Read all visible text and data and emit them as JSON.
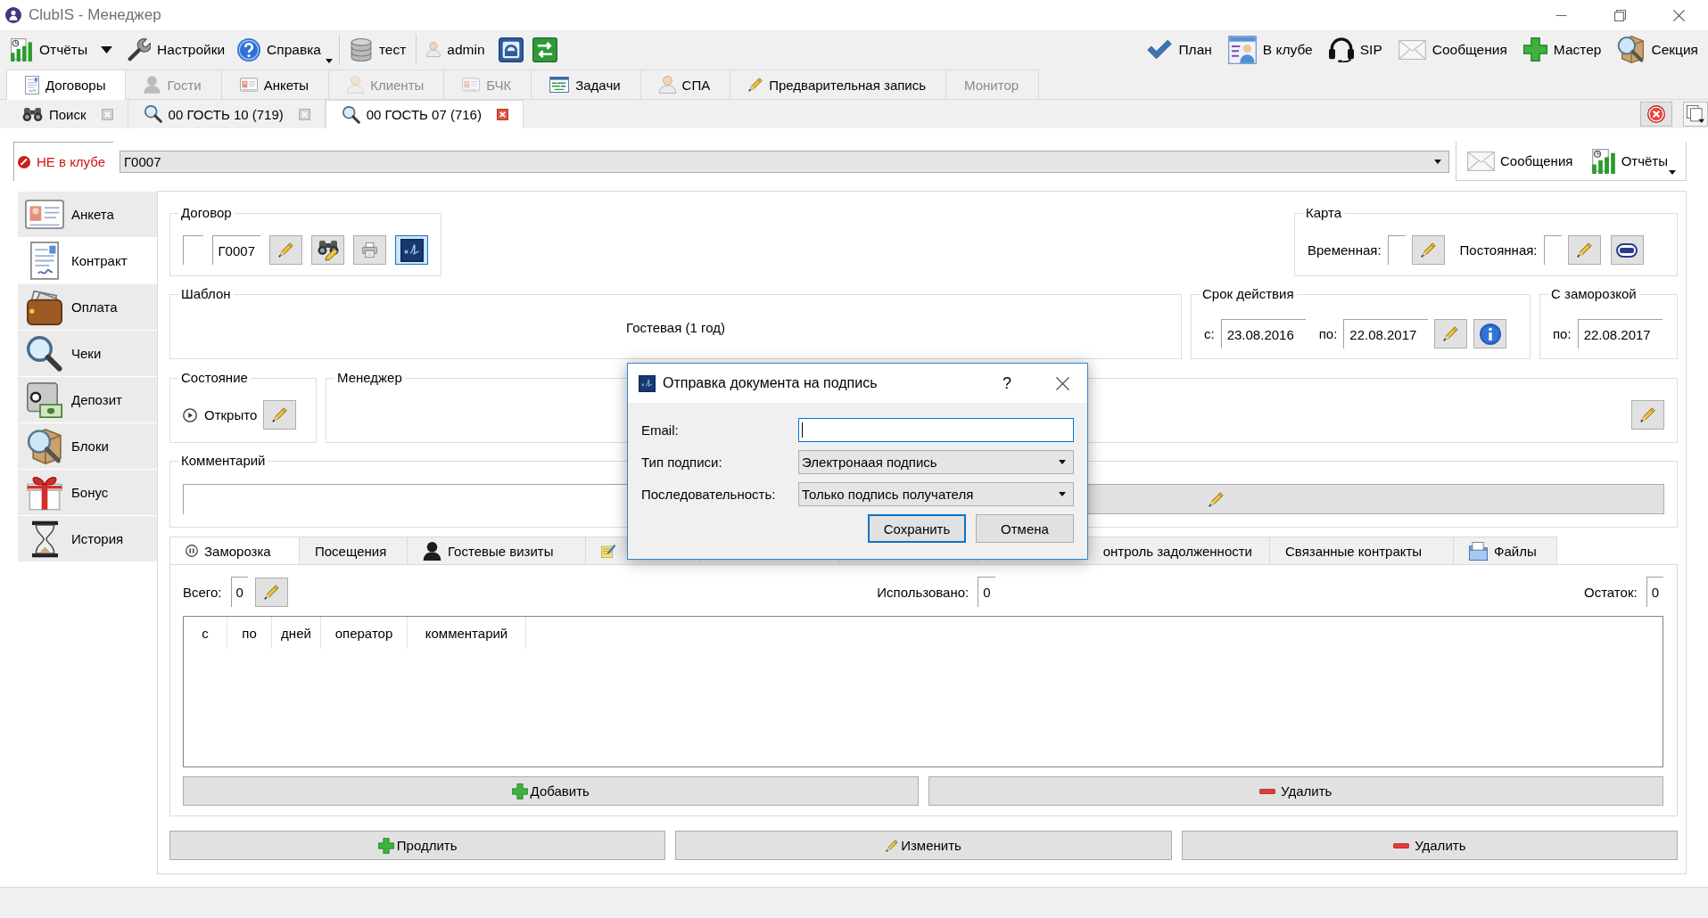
{
  "window": {
    "title": "ClubIS - Менеджер"
  },
  "toolbar": {
    "left": [
      "Отчёты",
      "Настройки",
      "Справка",
      "тест",
      "admin"
    ],
    "right": [
      "План",
      "В клубе",
      "SIP",
      "Сообщения",
      "Мастер",
      "Секция"
    ]
  },
  "main_tabs": [
    {
      "label": "Договоры",
      "selected": true,
      "disabled": false
    },
    {
      "label": "Гости",
      "selected": false,
      "disabled": true
    },
    {
      "label": "Анкеты",
      "selected": false,
      "disabled": false
    },
    {
      "label": "Клиенты",
      "selected": false,
      "disabled": true
    },
    {
      "label": "БЧК",
      "selected": false,
      "disabled": true
    },
    {
      "label": "Задачи",
      "selected": false,
      "disabled": false
    },
    {
      "label": "СПА",
      "selected": false,
      "disabled": false
    },
    {
      "label": "Предварительная запись",
      "selected": false,
      "disabled": false
    },
    {
      "label": "Монитор",
      "selected": false,
      "disabled": true
    }
  ],
  "document_tabs": [
    {
      "label": "Поиск",
      "selected": false
    },
    {
      "label": "00 ГОСТЬ 10 (719)",
      "selected": false
    },
    {
      "label": "00 ГОСТЬ 07 (716)",
      "selected": true
    }
  ],
  "client_bar": {
    "status": "НЕ в клубе",
    "client": "Г0007",
    "buttons": [
      "Сообщения",
      "Отчёты"
    ]
  },
  "sidebar": {
    "items": [
      {
        "label": "Анкета",
        "selected": false
      },
      {
        "label": "Контракт",
        "selected": true
      },
      {
        "label": "Оплата",
        "selected": false
      },
      {
        "label": "Чеки",
        "selected": false
      },
      {
        "label": "Депозит",
        "selected": false
      },
      {
        "label": "Блоки",
        "selected": false
      },
      {
        "label": "Бонус",
        "selected": false
      },
      {
        "label": "История",
        "selected": false
      }
    ]
  },
  "contract": {
    "title": "Договор",
    "number": "Г0007",
    "tool_buttons": [
      {
        "pressed": false
      },
      {
        "pressed": false
      },
      {
        "pressed": false
      },
      {
        "pressed": true
      }
    ]
  },
  "card": {
    "title": "Карта",
    "temporary_label": "Временная:",
    "permanent_label": "Постоянная:"
  },
  "template": {
    "title": "Шаблон",
    "value": "Гостевая (1 год)"
  },
  "validity": {
    "title": "Срок действия",
    "from_label": "с:",
    "from": "23.08.2016",
    "to_label": "по:",
    "to": "22.08.2017"
  },
  "with_freeze": {
    "title": "С заморозкой",
    "to_label": "по:",
    "to": "22.08.2017"
  },
  "state": {
    "title": "Состояние",
    "value": "Открыто"
  },
  "manager": {
    "title": "Менеджер"
  },
  "comment": {
    "title": "Комментарий"
  },
  "detail_tabs": [
    {
      "label": "Заморозка",
      "selected": true
    },
    {
      "label": "Посещения",
      "selected": false
    },
    {
      "label": "Гостевые визиты",
      "selected": false
    },
    {
      "selected": false
    },
    {
      "label": "онтроль задолженности",
      "selected": false
    },
    {
      "label": "Связанные контракты",
      "selected": false
    },
    {
      "label": "Файлы",
      "selected": false
    }
  ],
  "freeze": {
    "total_label": "Всего:",
    "total": "0",
    "used_label": "Использовано:",
    "used": "0",
    "rest_label": "Остаток:",
    "rest": "0",
    "columns": [
      "с",
      "по",
      "дней",
      "оператор",
      "комментарий"
    ],
    "buttons": [
      "Добавить",
      "Удалить"
    ]
  },
  "actions": [
    "Продлить",
    "Изменить",
    "Удалить"
  ],
  "dialog": {
    "title": "Отправка документа на подпись",
    "help": "?",
    "fields": [
      {
        "label": "Email:",
        "kind": "text",
        "focused": true
      },
      {
        "label": "Тип подписи:",
        "kind": "combo",
        "value": "Электронаая подпись",
        "focused": false
      },
      {
        "label": "Последовательность:",
        "kind": "combo",
        "value": "Только подпись получателя",
        "focused": false
      }
    ],
    "buttons": [
      {
        "label": "Сохранить",
        "default": true
      },
      {
        "label": "Отмена",
        "default": false
      }
    ]
  }
}
